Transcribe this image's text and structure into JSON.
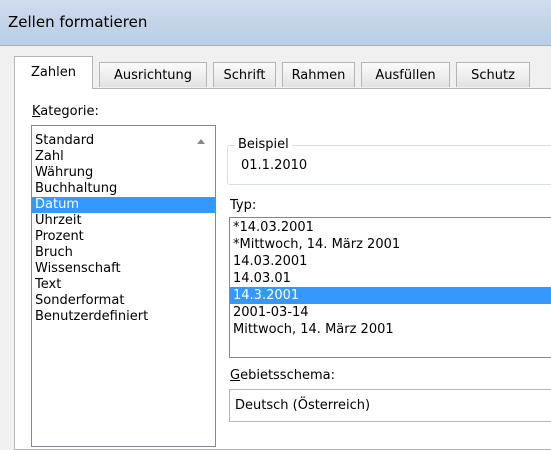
{
  "window": {
    "title": "Zellen formatieren"
  },
  "tabs": [
    "Zahlen",
    "Ausrichtung",
    "Schrift",
    "Rahmen",
    "Ausfüllen",
    "Schutz"
  ],
  "active_tab": "Zahlen",
  "kategorie": {
    "label": "Kategorie:",
    "items": [
      "Standard",
      "Zahl",
      "Währung",
      "Buchhaltung",
      "Datum",
      "Uhrzeit",
      "Prozent",
      "Bruch",
      "Wissenschaft",
      "Text",
      "Sonderformat",
      "Benutzerdefiniert"
    ],
    "selected": "Datum"
  },
  "beispiel": {
    "label": "Beispiel",
    "value": "01.1.2010"
  },
  "typ": {
    "label": "Typ:",
    "items": [
      "*14.03.2001",
      "*Mittwoch, 14. März 2001",
      "14.03.2001",
      "14.03.01",
      "14.3.2001",
      "2001-03-14",
      "Mittwoch, 14. März 2001"
    ],
    "selected": "14.3.2001"
  },
  "gebietsschema": {
    "label": "Gebietsschema:",
    "value": "Deutsch (Österreich)"
  },
  "colors": {
    "selection": "#3399ff",
    "titlebar": "#c4d5ea"
  }
}
